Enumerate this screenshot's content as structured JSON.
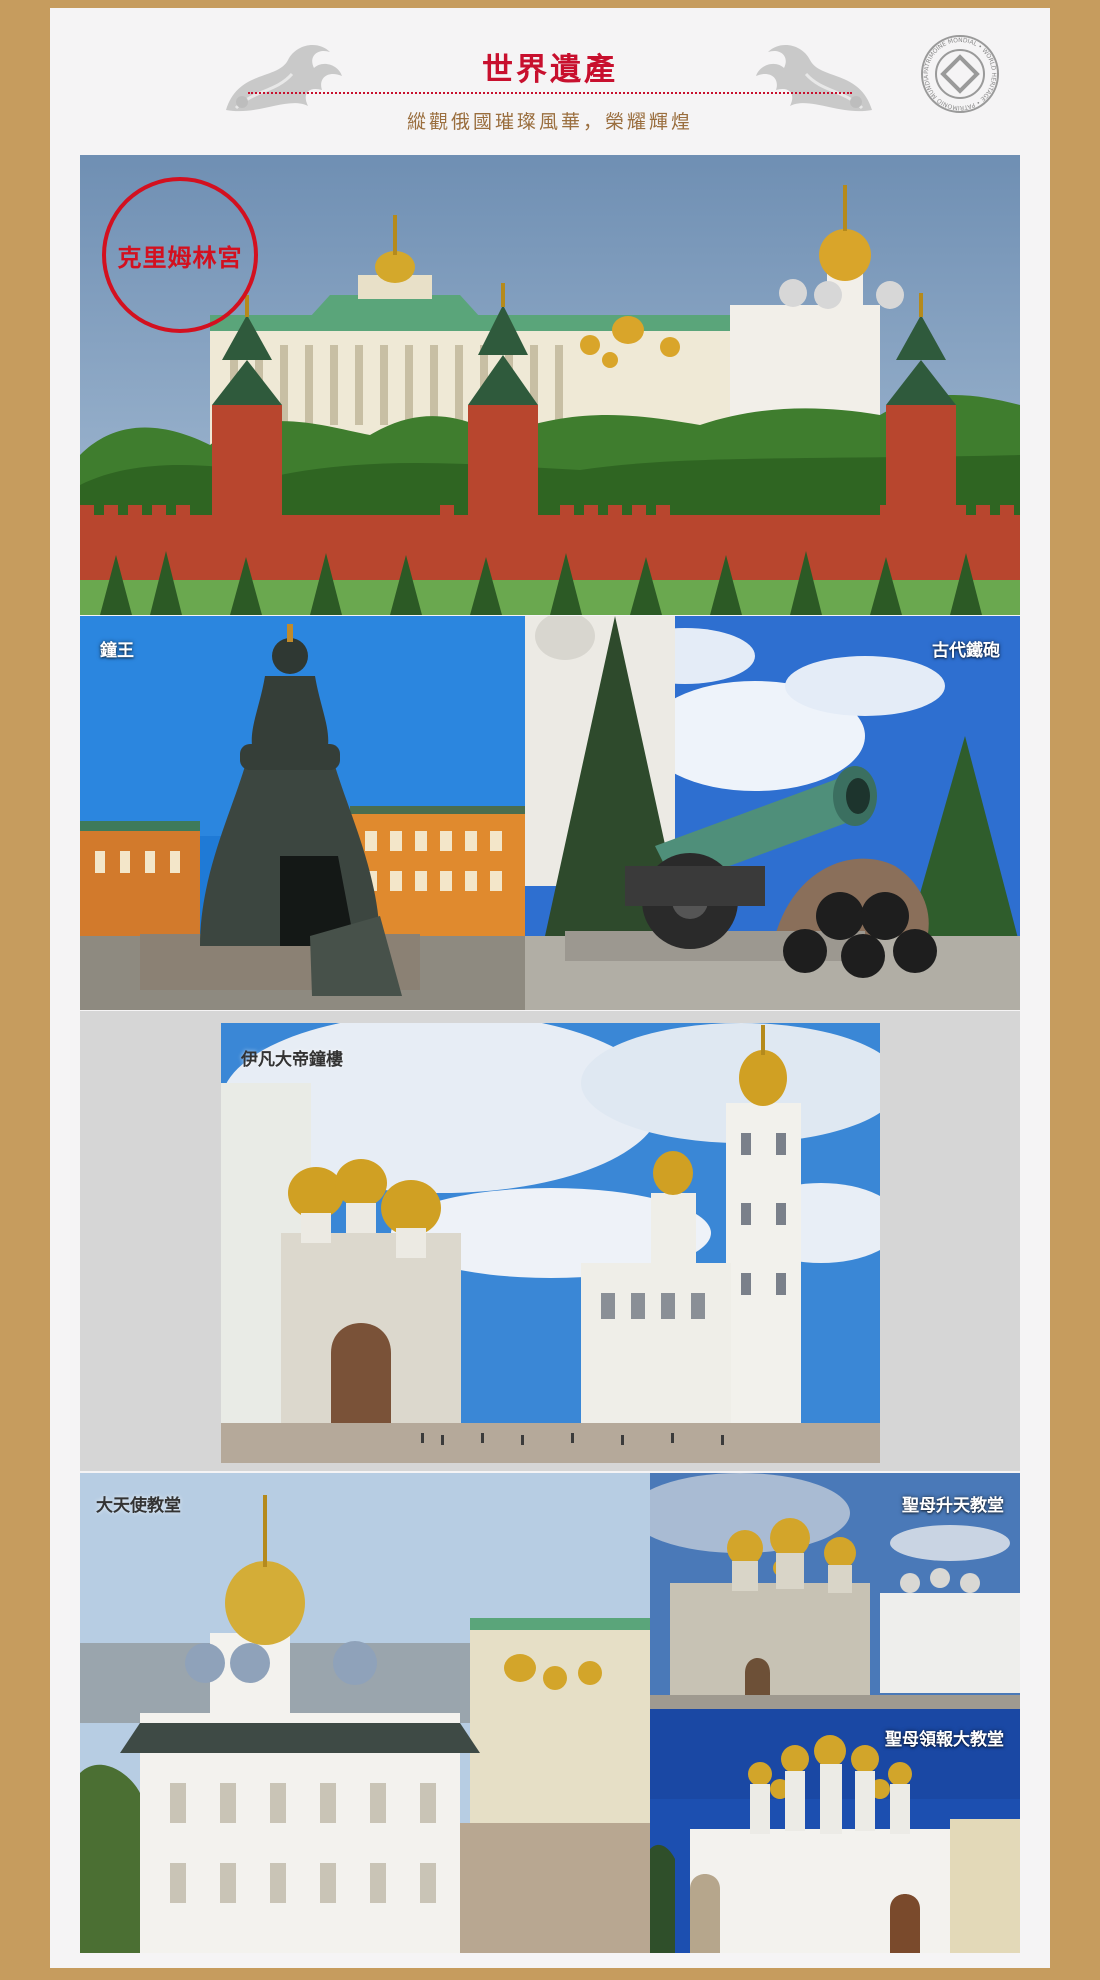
{
  "header": {
    "title": "世界遺產",
    "subtitle": "縱觀俄國璀璨風華，榮耀輝煌",
    "emblem_text": "PATRIMOINE MONDIAL • WORLD HERITAGE • PATRIMONIO MUNDIAL"
  },
  "hero": {
    "stamp_label": "克里姆林宮"
  },
  "photos": {
    "bell": {
      "caption": "鐘王"
    },
    "cannon": {
      "caption": "古代鐵砲"
    },
    "bell_tower": {
      "caption": "伊凡大帝鐘樓"
    },
    "archangel": {
      "caption": "大天使教堂"
    },
    "dormition": {
      "caption": "聖母升天教堂"
    },
    "annunciation": {
      "caption": "聖母領報大教堂"
    }
  },
  "colors": {
    "frame": "#c69c5e",
    "accent_red": "#c8102e",
    "subtitle_brown": "#9a6e3e"
  },
  "icons": [
    "acanthus-flourish-icon",
    "world-heritage-emblem-icon"
  ]
}
